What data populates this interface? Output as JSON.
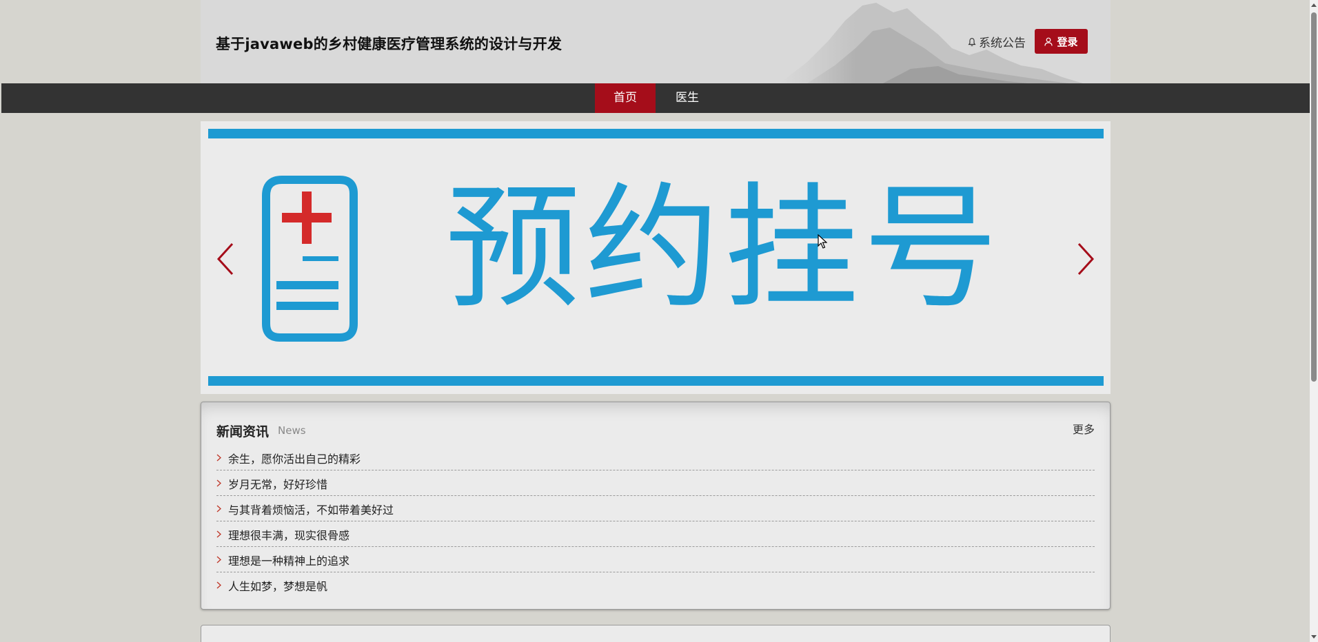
{
  "header": {
    "title": "基于javaweb的乡村健康医疗管理系统的设计与开发",
    "notice_label": "系统公告",
    "login_label": "登录"
  },
  "nav": {
    "items": [
      {
        "label": "首页",
        "active": true
      },
      {
        "label": "医生",
        "active": false
      }
    ]
  },
  "banner": {
    "text": "预约挂号",
    "accent_color": "#1e9ad2",
    "cross_color": "#d42a2a"
  },
  "news": {
    "title": "新闻资讯",
    "subtitle": "News",
    "more_label": "更多",
    "items": [
      "余生，愿你活出自己的精彩",
      "岁月无常，好好珍惜",
      "与其背着烦恼活，不如带着美好过",
      "理想很丰满，现实很骨感",
      "理想是一种精神上的追求",
      "人生如梦，梦想是帆"
    ]
  },
  "colors": {
    "brand_red": "#a50d1a",
    "nav_bg": "#333333",
    "page_bg": "#d6d5cf"
  }
}
